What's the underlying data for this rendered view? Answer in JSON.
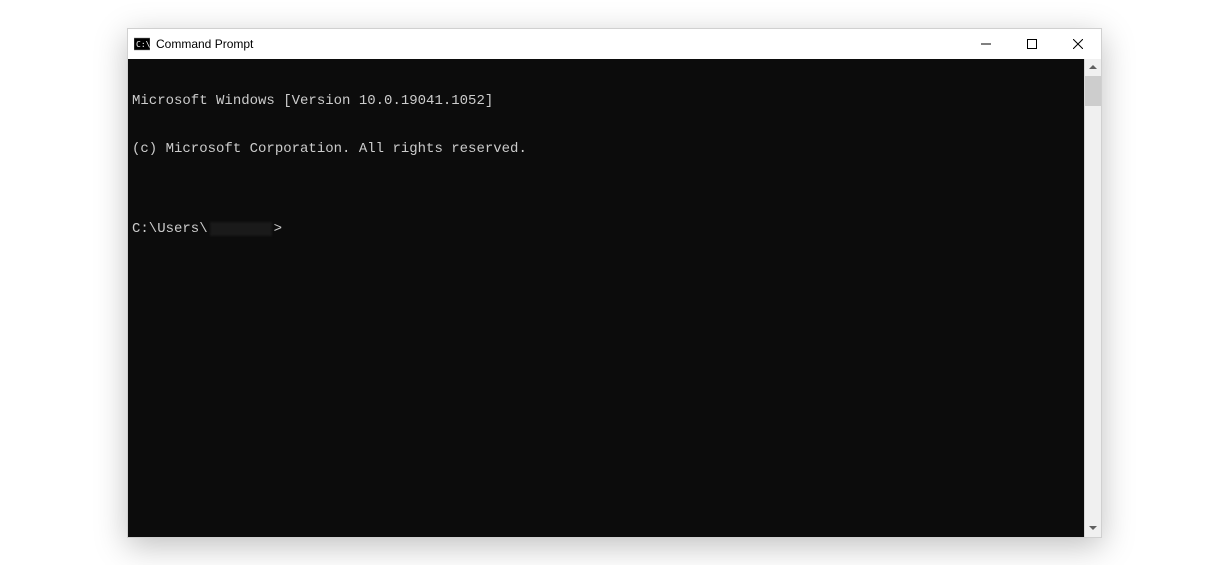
{
  "window": {
    "title": "Command Prompt"
  },
  "terminal": {
    "line1": "Microsoft Windows [Version 10.0.19041.1052]",
    "line2": "(c) Microsoft Corporation. All rights reserved.",
    "blank": "",
    "prompt_prefix": "C:\\Users\\",
    "prompt_suffix": ">"
  }
}
